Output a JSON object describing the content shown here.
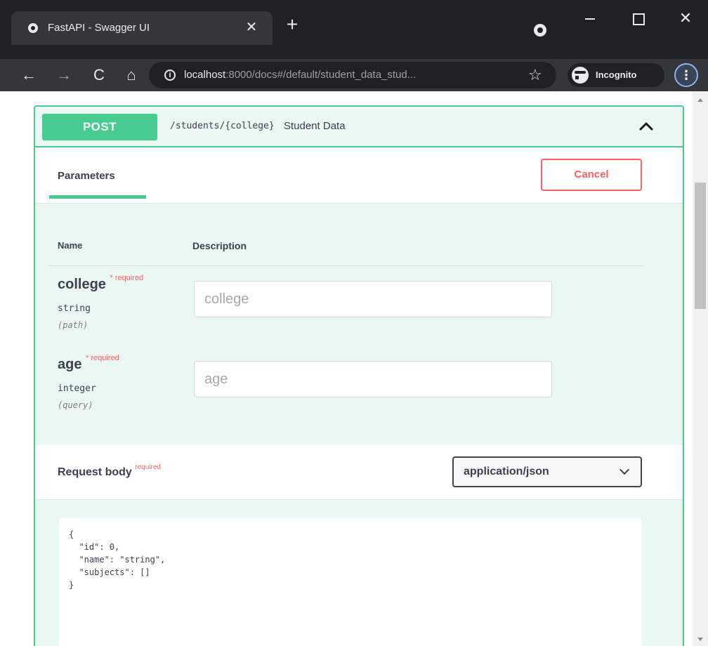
{
  "browser": {
    "tab_title": "FastAPI - Swagger UI",
    "tab_close_glyph": "✕",
    "new_tab_glyph": "+",
    "url_host": "localhost",
    "url_rest": ":8000/docs#/default/student_data_stud...",
    "incognito_label": "Incognito",
    "icons": {
      "back": "←",
      "forward": "→",
      "reload": "C",
      "home": "⌂",
      "info": "i",
      "star": "☆",
      "menu": "⋮",
      "close_window": "✕"
    }
  },
  "operation": {
    "method": "POST",
    "path": "/students/{college}",
    "summary": "Student Data",
    "accent_color": "#49cc90",
    "params_tab": "Parameters",
    "cancel_label": "Cancel",
    "col_name": "Name",
    "col_description": "Description",
    "required_mark": "* required",
    "parameters": [
      {
        "name": "college",
        "type": "string",
        "in": "(path)",
        "placeholder": "college"
      },
      {
        "name": "age",
        "type": "integer",
        "in": "(query)",
        "placeholder": "age"
      }
    ],
    "request_body_title": "Request body",
    "request_body_required": "required",
    "content_type": "application/json",
    "example_body": "{\n  \"id\": 0,\n  \"name\": \"string\",\n  \"subjects\": []\n}"
  }
}
